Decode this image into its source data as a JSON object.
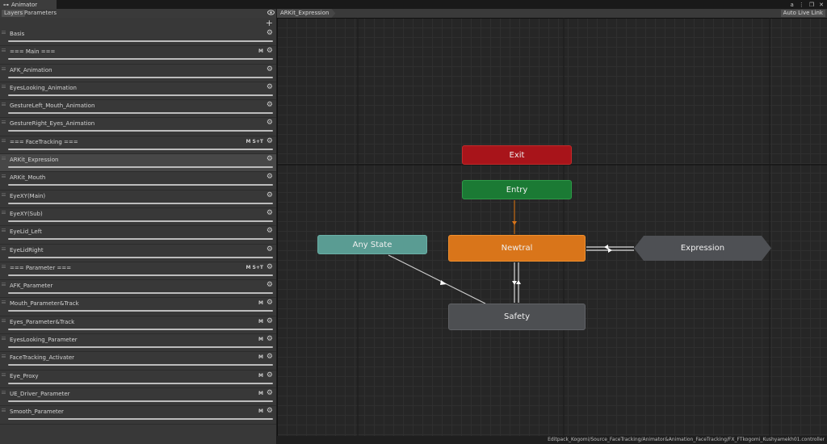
{
  "window": {
    "tab_title": "Animator",
    "tab_glyph": "⊶",
    "controls": [
      "a",
      "⋮",
      "❐",
      "✕"
    ]
  },
  "left_panel": {
    "tabs": [
      {
        "label": "Layers",
        "active": true
      },
      {
        "label": "Parameters",
        "active": false
      }
    ],
    "add_glyph": "+",
    "gear_glyph": "⚙",
    "layers": [
      {
        "name": "Basis",
        "flags": ""
      },
      {
        "name": "=== Main ===",
        "flags": "M"
      },
      {
        "name": "AFK_Animation",
        "flags": ""
      },
      {
        "name": "EyesLooking_Animation",
        "flags": ""
      },
      {
        "name": "GestureLeft_Mouth_Animation",
        "flags": ""
      },
      {
        "name": "GestureRight_Eyes_Animation",
        "flags": ""
      },
      {
        "name": "=== FaceTracking ===",
        "flags": "M S+T"
      },
      {
        "name": "ARKit_Expression",
        "flags": "",
        "selected": true
      },
      {
        "name": "ARKit_Mouth",
        "flags": ""
      },
      {
        "name": "EyeXY(Main)",
        "flags": ""
      },
      {
        "name": "EyeXY(Sub)",
        "flags": ""
      },
      {
        "name": "EyeLid_Left",
        "flags": ""
      },
      {
        "name": "EyeLidRight",
        "flags": ""
      },
      {
        "name": "=== Parameter ===",
        "flags": "M S+T"
      },
      {
        "name": "AFK_Parameter",
        "flags": ""
      },
      {
        "name": "Mouth_Parameter&Track",
        "flags": "M"
      },
      {
        "name": "Eyes_Parameter&Track",
        "flags": "M"
      },
      {
        "name": "EyesLooking_Parameter",
        "flags": "M"
      },
      {
        "name": "FaceTracking_Activater",
        "flags": "M"
      },
      {
        "name": "Eye_Proxy",
        "flags": "M"
      },
      {
        "name": "UE_Driver_Parameter",
        "flags": "M"
      },
      {
        "name": "Smooth_Parameter",
        "flags": "M"
      }
    ]
  },
  "graph": {
    "breadcrumb": "ARKit_Expression",
    "live_link_label": "Auto Live Link",
    "states": {
      "exit": "Exit",
      "entry": "Entry",
      "any_state": "Any State",
      "newtral": "Newtral",
      "safety": "Safety",
      "expression": "Expression"
    }
  },
  "status_bar": {
    "path": "Editpack_Kogomi/Source_FaceTracking/Animator&Animation_FaceTracking/FX_FTkogomi_Kushyamekh01.controller"
  }
}
